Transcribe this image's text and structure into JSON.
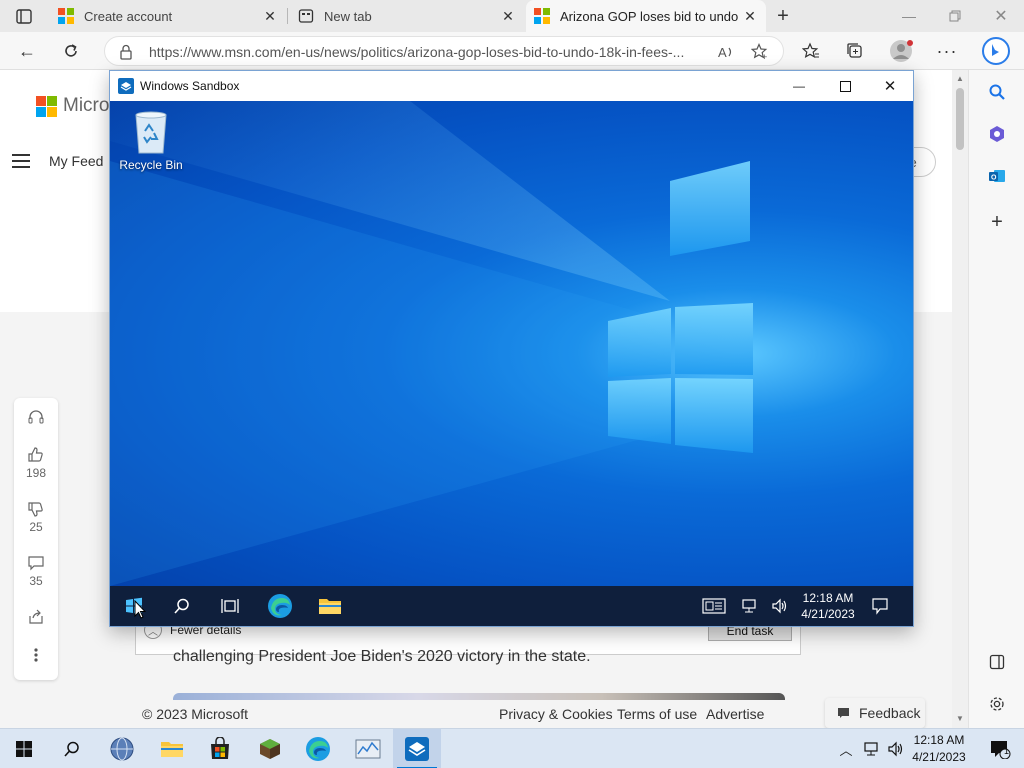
{
  "browser": {
    "tabs": [
      {
        "label": "Create account",
        "icon": "microsoft-logo-icon",
        "active": false
      },
      {
        "label": "New tab",
        "icon": "newtab-icon",
        "active": false
      },
      {
        "label": "Arizona GOP loses bid to undo $",
        "icon": "msn-icon",
        "active": true
      }
    ],
    "url": "https://www.msn.com/en-us/news/politics/arizona-gop-loses-bid-to-undo-18k-in-fees-..."
  },
  "msn": {
    "brand": "Micros",
    "nav_label": "My Feed",
    "personalize_label": "ze",
    "reactions": {
      "likes": "198",
      "dislikes": "25",
      "comments": "35"
    },
    "article_snippet": "challenging President Joe Biden's 2020 victory in the state.",
    "footer": {
      "copyright": "© 2023 Microsoft",
      "privacy": "Privacy & Cookies",
      "terms": "Terms of use",
      "advertise": "Advertise",
      "feedback": "Feedback"
    }
  },
  "task_manager": {
    "fewer_details": "Fewer details",
    "end_task": "End task"
  },
  "sandbox": {
    "title": "Windows Sandbox",
    "desktop_icon_label": "Recycle Bin",
    "clock_time": "12:18 AM",
    "clock_date": "4/21/2023"
  },
  "host_taskbar": {
    "clock_time": "12:18 AM",
    "clock_date": "4/21/2023",
    "notification_count": "1"
  },
  "colors": {
    "accent": "#0078d4",
    "sandbox_taskbar": "#0f1f3c",
    "host_taskbar": "#dbe6f3"
  }
}
